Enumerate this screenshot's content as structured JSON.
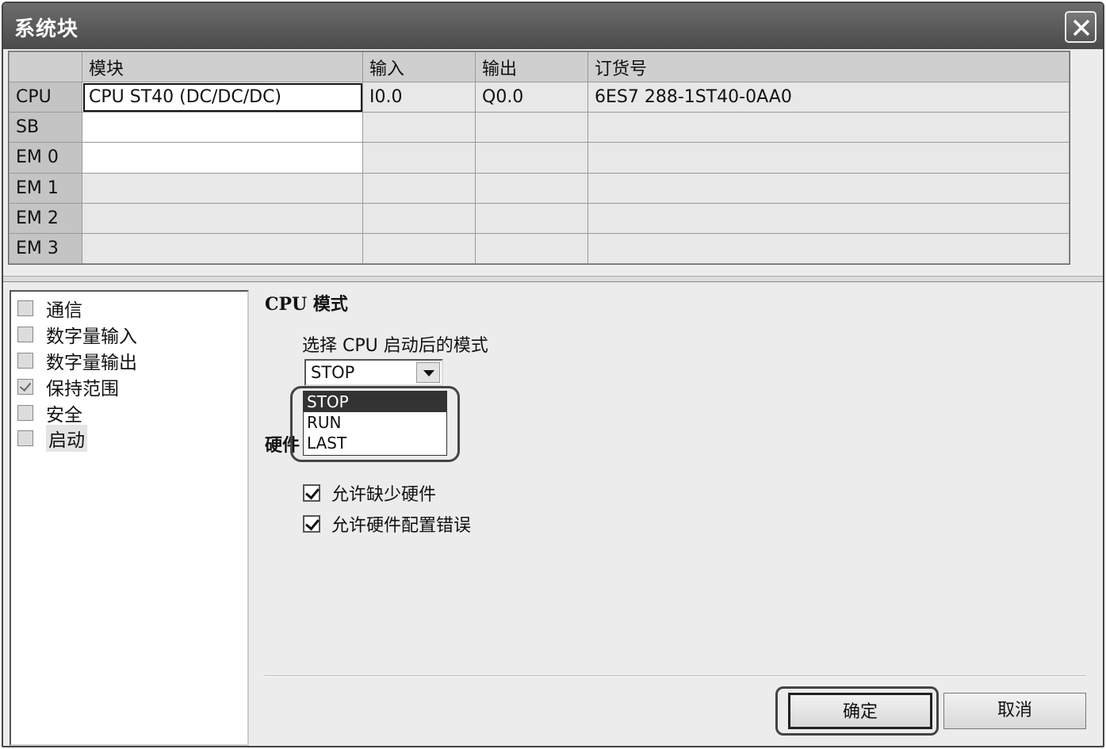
{
  "window": {
    "title": "系统块"
  },
  "grid": {
    "headers": [
      "",
      "模块",
      "输入",
      "输出",
      "订货号"
    ],
    "rows": [
      {
        "slot": "CPU",
        "module": "CPU ST40 (DC/DC/DC)",
        "input": "I0.0",
        "output": "Q0.0",
        "order": "6ES7 288-1ST40-0AA0"
      },
      {
        "slot": "SB",
        "module": "",
        "input": "",
        "output": "",
        "order": ""
      },
      {
        "slot": "EM 0",
        "module": "",
        "input": "",
        "output": "",
        "order": ""
      },
      {
        "slot": "EM 1",
        "module": "",
        "input": "",
        "output": "",
        "order": ""
      },
      {
        "slot": "EM 2",
        "module": "",
        "input": "",
        "output": "",
        "order": ""
      },
      {
        "slot": "EM 3",
        "module": "",
        "input": "",
        "output": "",
        "order": ""
      }
    ]
  },
  "tree": {
    "items": [
      {
        "label": "通信"
      },
      {
        "label": "数字量输入"
      },
      {
        "label": "数字量输出"
      },
      {
        "label": "保持范围"
      },
      {
        "label": "安全"
      },
      {
        "label": "启动"
      }
    ]
  },
  "panel": {
    "cpu_mode_title": "CPU 模式",
    "mode_prompt": "选择 CPU 启动后的模式",
    "mode_selected": "STOP",
    "mode_options": [
      "STOP",
      "RUN",
      "LAST"
    ],
    "hardware_title": "硬件",
    "allow_missing_hw": "允许缺少硬件",
    "allow_config_error": "允许硬件配置错误"
  },
  "buttons": {
    "ok": "确定",
    "cancel": "取消"
  }
}
